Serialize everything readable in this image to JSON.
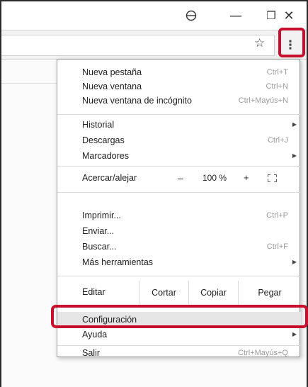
{
  "window": {
    "profile_icon": "profile-icon",
    "minimize_glyph": "—",
    "restore_glyph": "❐",
    "close_glyph": "✕"
  },
  "toolbar": {
    "star_glyph": "☆",
    "menu_glyph": "⋮"
  },
  "menu": {
    "new_tab": {
      "label": "Nueva pestaña",
      "shortcut": "Ctrl+T"
    },
    "new_window": {
      "label": "Nueva ventana",
      "shortcut": "Ctrl+N"
    },
    "new_incognito": {
      "label": "Nueva ventana de incógnito",
      "shortcut": "Ctrl+Mayús+N"
    },
    "history": {
      "label": "Historial"
    },
    "downloads": {
      "label": "Descargas",
      "shortcut": "Ctrl+J"
    },
    "bookmarks": {
      "label": "Marcadores"
    },
    "zoom": {
      "label": "Acercar/alejar",
      "minus": "–",
      "value": "100 %",
      "plus": "+"
    },
    "print": {
      "label": "Imprimir...",
      "shortcut": "Ctrl+P"
    },
    "cast": {
      "label": "Enviar..."
    },
    "find": {
      "label": "Buscar...",
      "shortcut": "Ctrl+F"
    },
    "more_tools": {
      "label": "Más herramientas"
    },
    "edit": {
      "label": "Editar",
      "cut": "Cortar",
      "copy": "Copiar",
      "paste": "Pegar"
    },
    "settings": {
      "label": "Configuración"
    },
    "help": {
      "label": "Ayuda"
    },
    "exit": {
      "label": "Salir",
      "shortcut": "Ctrl+Mayús+Q"
    },
    "submenu_arrow": "▶"
  },
  "colors": {
    "highlight": "#c8102e",
    "hover_bg": "#e6e6e6",
    "shortcut_text": "#9a9a9a"
  }
}
